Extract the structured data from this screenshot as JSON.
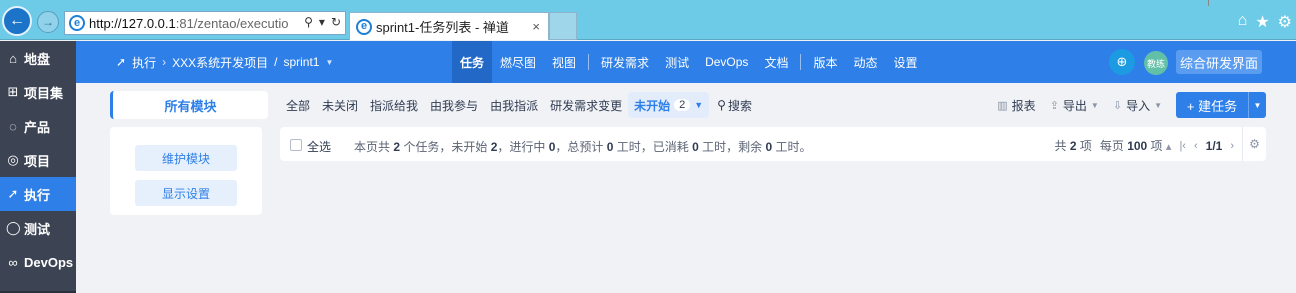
{
  "browser": {
    "url_host": "http://127.0.0.1",
    "url_rest": ":81/zentao/executio",
    "tab_title": "sprint1-任务列表 - 禅道",
    "tab_close": "×"
  },
  "sidebar": {
    "items": [
      {
        "label": "地盘",
        "icon": "home-icon"
      },
      {
        "label": "项目集",
        "icon": "grid-icon"
      },
      {
        "label": "产品",
        "icon": "lightbulb-icon"
      },
      {
        "label": "项目",
        "icon": "project-icon"
      },
      {
        "label": "执行",
        "icon": "run-icon",
        "active": true
      },
      {
        "label": "测试",
        "icon": "search-test-icon"
      },
      {
        "label": "DevOps",
        "icon": "infinity-icon"
      }
    ]
  },
  "appbar": {
    "breadcrumb": {
      "section": "执行",
      "project": "XXX系统开发项目",
      "slash": "/",
      "sprint": "sprint1"
    },
    "menu": [
      "任务",
      "燃尽图",
      "视图",
      "研发需求",
      "测试",
      "DevOps",
      "文档",
      "版本",
      "动态",
      "设置"
    ],
    "avatar_text": "教练",
    "mode_button": "综合研发界面"
  },
  "modules": {
    "title": "所有模块",
    "maintain": "维护模块",
    "display": "显示设置"
  },
  "filters": {
    "items": [
      "全部",
      "未关闭",
      "指派给我",
      "由我参与",
      "由我指派",
      "研发需求变更"
    ],
    "active_label": "未开始",
    "active_count": "2",
    "search": "搜索"
  },
  "tools": {
    "report": "报表",
    "export": "导出",
    "import": "导入",
    "create": "+ 建任务"
  },
  "listbar": {
    "select_all": "全选",
    "summary": {
      "p1": "本页共 ",
      "total": "2",
      "p2": " 个任务，未开始 ",
      "notstarted": "2",
      "p3": "，进行中 ",
      "doing": "0",
      "p4": "，总预计 ",
      "estimate": "0",
      "p5": " 工时，已消耗 ",
      "consumed": "0",
      "p6": " 工时，剩余 ",
      "left": "0",
      "p7": " 工时。"
    },
    "pager": {
      "total_prefix": "共 ",
      "total": "2",
      "total_suffix": " 项",
      "per_prefix": "每页 ",
      "per": "100",
      "per_suffix": " 项",
      "page": "1/1"
    }
  },
  "colors": {
    "accent": "#2e7fe8",
    "sidebar_bg": "#3c4353",
    "browser_bar": "#6ecbe8"
  }
}
